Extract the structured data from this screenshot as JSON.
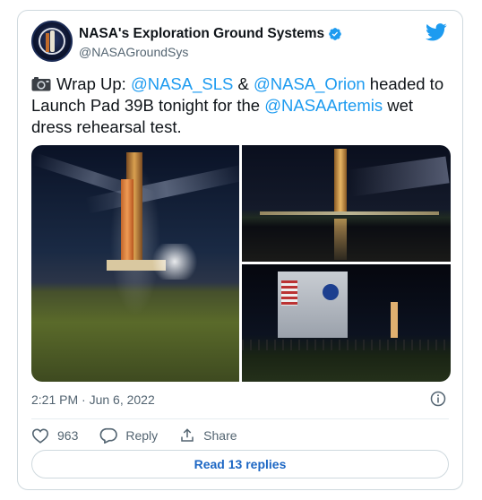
{
  "author": {
    "display_name": "NASA's Exploration Ground Systems",
    "handle": "@NASAGroundSys",
    "avatar_icon": "nasa-egs-patch-icon",
    "verified_icon": "verified-badge-icon"
  },
  "tweet": {
    "segments": [
      {
        "text": "Wrap Up: ",
        "kind": "text"
      },
      {
        "text": "@NASA_SLS",
        "kind": "mention"
      },
      {
        "text": " & ",
        "kind": "text"
      },
      {
        "text": "@NASA_Orion",
        "kind": "mention"
      },
      {
        "text": " headed to Launch Pad 39B tonight for the ",
        "kind": "text"
      },
      {
        "text": "@NASAArtemis",
        "kind": "mention"
      },
      {
        "text": " wet dress rehearsal test.",
        "kind": "text"
      }
    ],
    "emoji_icon": "camera-icon",
    "timestamp": "2:21 PM · Jun 6, 2022",
    "likes": "963",
    "reply_label": "Reply",
    "share_label": "Share",
    "read_replies_label": "Read 13 replies"
  },
  "colors": {
    "mention": "#1d9bf0",
    "secondary_text": "#536471",
    "replies_link": "#1d67c4",
    "border": "#cfd9de"
  }
}
